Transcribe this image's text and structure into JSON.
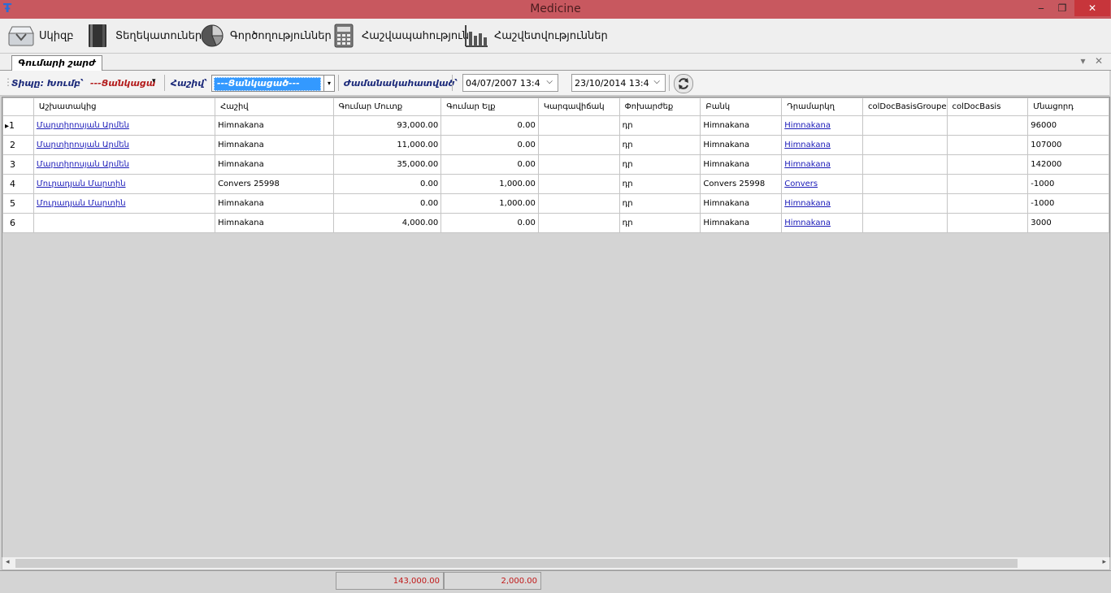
{
  "window": {
    "title": "Medicine",
    "controls": {
      "minimize": "‒",
      "maximize": "❐",
      "close": "✕"
    }
  },
  "menu": {
    "items": [
      {
        "label": "Սկիզբ",
        "icon": "inbox-icon"
      },
      {
        "label": "Տեղեկատուներ",
        "icon": "book-icon"
      },
      {
        "label": "Գործողություններ",
        "icon": "pie-chart-icon"
      },
      {
        "label": "Հաշվապահություն",
        "icon": "calculator-icon"
      },
      {
        "label": "Հաշվետվություններ",
        "icon": "bar-chart-icon"
      }
    ]
  },
  "tabs": {
    "active": "Գումարի շարժ",
    "dropdown": "▾",
    "close": "✕"
  },
  "filter": {
    "type_label": "Տիպը: Խումբ՝",
    "type_value": "---Ցանկացա",
    "account_label": "Հաշիվ՝",
    "account_value": "---Ցանկացած---",
    "period_label": "Ժամանակահատված՝",
    "date_from": "04/07/2007 13:4",
    "date_to": "23/10/2014 13:4",
    "arrow": "▾",
    "date_arrow": "⌵"
  },
  "grid": {
    "columns": [
      "Աշխատակից",
      "Հաշիվ",
      "Գումար Մուտք",
      "Գումար Ելք",
      "Կարգավիճակ",
      "Փոխարժեք",
      "Բանկ",
      "Դրամարկղ",
      "colDocBasisGroupe",
      "colDocBasis",
      "Մնացորդ"
    ],
    "current_row_marker": "▸",
    "rows": [
      {
        "n": "1",
        "employee": "Մարտիրոսյան Արմեն",
        "account": "Himnakana",
        "in": "93,000.00",
        "out": "0.00",
        "status": "",
        "rate": "դր",
        "bank": "Himnakana",
        "cash": "Himnakana",
        "basisgroup": "",
        "basis": "",
        "balance": "96000"
      },
      {
        "n": "2",
        "employee": "Մարտիրոսյան Արմեն",
        "account": "Himnakana",
        "in": "11,000.00",
        "out": "0.00",
        "status": "",
        "rate": "դր",
        "bank": "Himnakana",
        "cash": "Himnakana",
        "basisgroup": "",
        "basis": "",
        "balance": "107000"
      },
      {
        "n": "3",
        "employee": "Մարտիրոսյան Արմեն",
        "account": "Himnakana",
        "in": "35,000.00",
        "out": "0.00",
        "status": "",
        "rate": "դր",
        "bank": "Himnakana",
        "cash": "Himnakana",
        "basisgroup": "",
        "basis": "",
        "balance": "142000"
      },
      {
        "n": "4",
        "employee": "Մուրադյան Մարտին",
        "account": "Convers 25998",
        "in": "0.00",
        "out": "1,000.00",
        "status": "",
        "rate": "դր",
        "bank": "Convers 25998",
        "cash": "Convers",
        "basisgroup": "",
        "basis": "",
        "balance": "-1000"
      },
      {
        "n": "5",
        "employee": "Մուրադյան Մարտին",
        "account": "Himnakana",
        "in": "0.00",
        "out": "1,000.00",
        "status": "",
        "rate": "դր",
        "bank": "Himnakana",
        "cash": "Himnakana",
        "basisgroup": "",
        "basis": "",
        "balance": "-1000"
      },
      {
        "n": "6",
        "employee": "",
        "account": "Himnakana",
        "in": "4,000.00",
        "out": "0.00",
        "status": "",
        "rate": "դր",
        "bank": "Himnakana",
        "cash": "Himnakana",
        "basisgroup": "",
        "basis": "",
        "balance": "3000"
      }
    ]
  },
  "scroll": {
    "left": "◂",
    "right": "▸"
  },
  "totals": {
    "in": "143,000.00",
    "out": "2,000.00"
  },
  "colors": {
    "titlebar": "#c8585f",
    "total_text": "#c01818",
    "link": "#1a1ab8",
    "selected_combo": "#3399ff"
  }
}
